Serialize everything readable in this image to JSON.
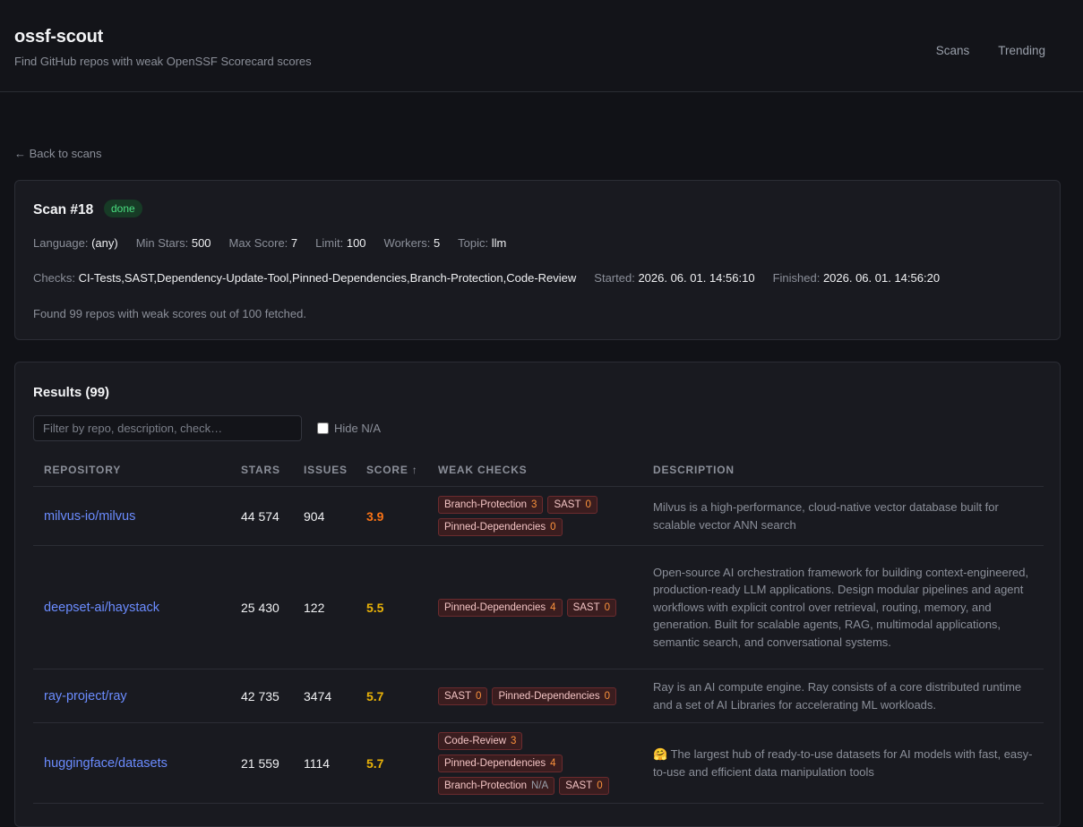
{
  "header": {
    "title": "ossf-scout",
    "subtitle": "Find GitHub repos with weak OpenSSF Scorecard scores",
    "nav": [
      "Scans",
      "Trending"
    ]
  },
  "back_link": "← Back to scans",
  "scan": {
    "title": "Scan #18",
    "status": "done",
    "row1": [
      {
        "k": "Language:",
        "v": "(any)"
      },
      {
        "k": "Min Stars:",
        "v": "500"
      },
      {
        "k": "Max Score:",
        "v": "7"
      },
      {
        "k": "Limit:",
        "v": "100"
      },
      {
        "k": "Workers:",
        "v": "5"
      },
      {
        "k": "Topic:",
        "v": "llm"
      }
    ],
    "row2": [
      {
        "k": "Checks:",
        "v": "CI-Tests,SAST,Dependency-Update-Tool,Pinned-Dependencies,Branch-Protection,Code-Review"
      },
      {
        "k": "Started:",
        "v": "2026. 06. 01. 14:56:10"
      },
      {
        "k": "Finished:",
        "v": "2026. 06. 01. 14:56:20"
      }
    ],
    "summary": "Found 99 repos with weak scores out of 100 fetched."
  },
  "results": {
    "title": "Results (99)",
    "filter_placeholder": "Filter by repo, description, check…",
    "hide_na_label": "Hide N/A",
    "columns": [
      "REPOSITORY",
      "STARS",
      "ISSUES",
      "SCORE ↑",
      "WEAK CHECKS",
      "DESCRIPTION"
    ],
    "score_colors": {
      "low": "#f97316",
      "mid": "#eab308"
    },
    "rows": [
      {
        "repo": "milvus-io/milvus",
        "stars": "44 574",
        "issues": "904",
        "score": "3.9",
        "score_level": "low",
        "checks": [
          {
            "name": "Branch-Protection",
            "val": "3"
          },
          {
            "name": "SAST",
            "val": "0"
          },
          {
            "name": "Pinned-Dependencies",
            "val": "0"
          }
        ],
        "description": "Milvus is a high-performance, cloud-native vector database built for scalable vector ANN search"
      },
      {
        "repo": "deepset-ai/haystack",
        "stars": "25 430",
        "issues": "122",
        "score": "5.5",
        "score_level": "mid",
        "checks": [
          {
            "name": "Pinned-Dependencies",
            "val": "4"
          },
          {
            "name": "SAST",
            "val": "0"
          }
        ],
        "description": "Open-source AI orchestration framework for building context-engineered, production-ready LLM applications. Design modular pipelines and agent workflows with explicit control over retrieval, routing, memory, and generation. Built for scalable agents, RAG, multimodal applications, semantic search, and conversational systems."
      },
      {
        "repo": "ray-project/ray",
        "stars": "42 735",
        "issues": "3474",
        "score": "5.7",
        "score_level": "mid",
        "checks": [
          {
            "name": "SAST",
            "val": "0"
          },
          {
            "name": "Pinned-Dependencies",
            "val": "0"
          }
        ],
        "description": "Ray is an AI compute engine. Ray consists of a core distributed runtime and a set of AI Libraries for accelerating ML workloads."
      },
      {
        "repo": "huggingface/datasets",
        "stars": "21 559",
        "issues": "1114",
        "score": "5.7",
        "score_level": "mid",
        "checks": [
          {
            "name": "Code-Review",
            "val": "3"
          },
          {
            "name": "Pinned-Dependencies",
            "val": "4"
          },
          {
            "name": "Branch-Protection",
            "val": "N/A"
          },
          {
            "name": "SAST",
            "val": "0"
          }
        ],
        "description": "🤗 The largest hub of ready-to-use datasets for AI models with fast, easy-to-use and efficient data manipulation tools"
      }
    ]
  }
}
